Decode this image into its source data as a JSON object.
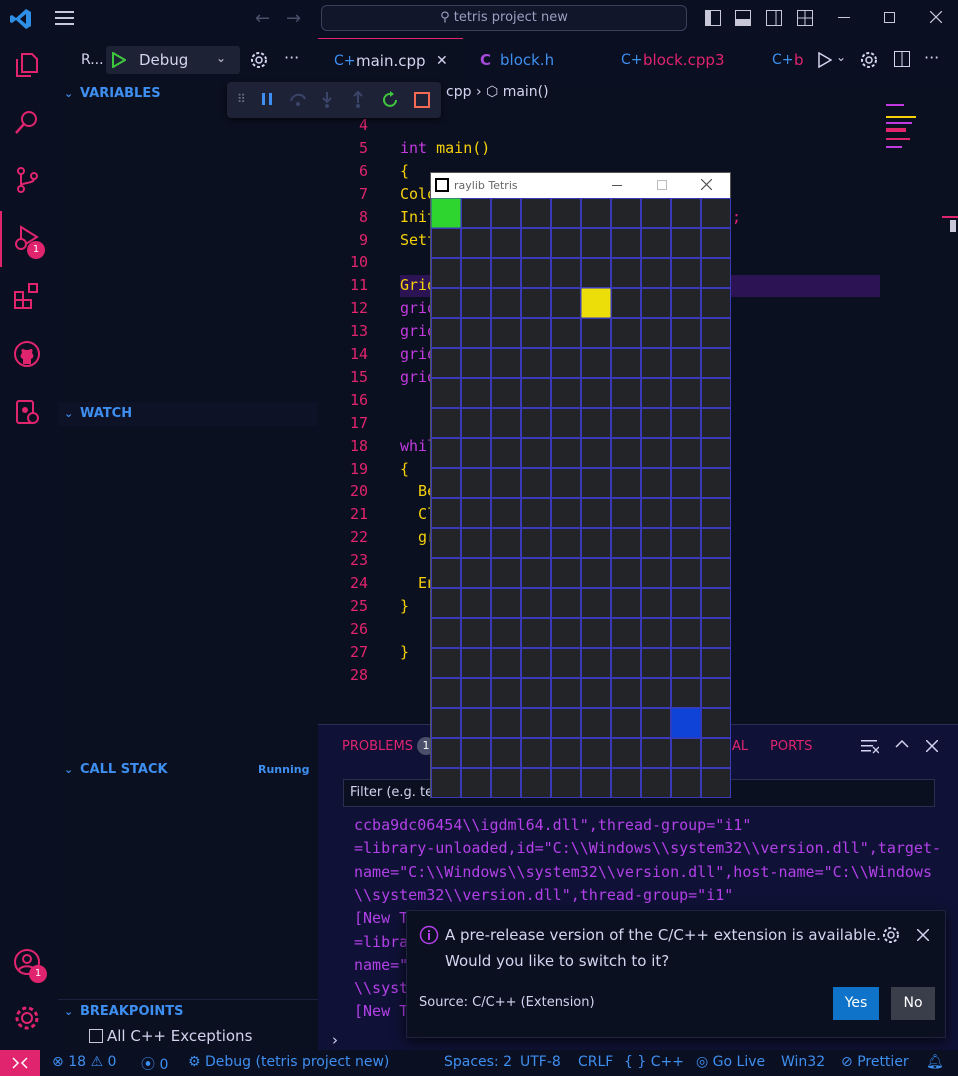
{
  "titlebar": {
    "search_text": "tetris project new"
  },
  "activity": {
    "debug_badge": "1",
    "accounts_badge": "1"
  },
  "sidebar": {
    "run_label": "R...",
    "config_select": "Debug",
    "variables": "VARIABLES",
    "watch": "WATCH",
    "callstack": "CALL STACK",
    "callstack_state": "Running",
    "breakpoints": "BREAKPOINTS",
    "bp_item": "All C++ Exceptions"
  },
  "tabs": [
    {
      "label": "main.cpp"
    },
    {
      "label": "block.h"
    },
    {
      "label": "block.cpp",
      "badge": "3"
    },
    {
      "label": "b"
    }
  ],
  "breadcrumb": {
    "file": "cpp",
    "symbol": "main()"
  },
  "editor": {
    "lines": [
      {
        "n": "4",
        "t": ""
      },
      {
        "n": "5",
        "t": "int main()"
      },
      {
        "n": "6",
        "t": "{"
      },
      {
        "n": "7",
        "t": "Colo"
      },
      {
        "n": "8",
        "t": "Init"
      },
      {
        "n": "9",
        "t": "Sett"
      },
      {
        "n": "10",
        "t": ""
      },
      {
        "n": "11",
        "t": "Grid"
      },
      {
        "n": "12",
        "t": "grid"
      },
      {
        "n": "13",
        "t": "grid"
      },
      {
        "n": "14",
        "t": "grid"
      },
      {
        "n": "15",
        "t": "grid"
      },
      {
        "n": "16",
        "t": ""
      },
      {
        "n": "17",
        "t": ""
      },
      {
        "n": "18",
        "t": "whil"
      },
      {
        "n": "19",
        "t": "{"
      },
      {
        "n": "20",
        "t": "  Be"
      },
      {
        "n": "21",
        "t": "  Cl"
      },
      {
        "n": "22",
        "t": "  gr"
      },
      {
        "n": "23",
        "t": ""
      },
      {
        "n": "24",
        "t": "  En"
      },
      {
        "n": "25",
        "t": "}"
      },
      {
        "n": "26",
        "t": ""
      },
      {
        "n": "27",
        "t": "}"
      },
      {
        "n": "28",
        "t": ""
      }
    ],
    "line8_tail": ";"
  },
  "panel": {
    "tabs": {
      "problems": "PROBLEMS",
      "problems_count": "1",
      "terminal_tail": "AL",
      "ports": "PORTS"
    },
    "filter_placeholder": "Filter (e.g. text, !exclude)",
    "output": [
      "ccba9dc06454\\\\igdml64.dll\",thread-group=\"i1\"",
      "=library-unloaded,id=\"C:\\\\Windows\\\\system32\\\\version.dll\",target-",
      "name=\"C:\\\\Windows\\\\system32\\\\version.dll\",host-name=\"C:\\\\Windows",
      "\\\\system32\\\\version.dll\",thread-group=\"i1\"",
      "[New T",
      "=libra",
      "name=\"",
      "\\\\syst",
      "[New T"
    ]
  },
  "toast": {
    "line1": "A pre-release version of the C/C++ extension is available.",
    "line2": "Would you like to switch to it?",
    "source": "Source: C/C++ (Extension)",
    "yes": "Yes",
    "no": "No"
  },
  "raylib": {
    "title": "raylib Tetris",
    "cols": 10,
    "rows": 20,
    "bg_color": "#232428",
    "line_color": "#3a3ab8",
    "cells": [
      {
        "col": 0,
        "row": 0,
        "color": "#2fd52f"
      },
      {
        "col": 5,
        "row": 3,
        "color": "#ecdf09"
      },
      {
        "col": 8,
        "row": 17,
        "color": "#0f43d8"
      }
    ]
  },
  "status": {
    "errors": "18",
    "warnings": "0",
    "ports": "0",
    "debug": "Debug (tetris project new)",
    "spaces": "Spaces: 2",
    "encoding": "UTF-8",
    "eol": "CRLF",
    "language": "C++",
    "golive": "Go Live",
    "platform": "Win32",
    "prettier": "Prettier"
  },
  "colors": {
    "accent_pink": "#e0246e",
    "accent_blue": "#3e8ff0",
    "keyword": "#c23be0",
    "function": "#f6d10a",
    "output": "#b340e8"
  }
}
